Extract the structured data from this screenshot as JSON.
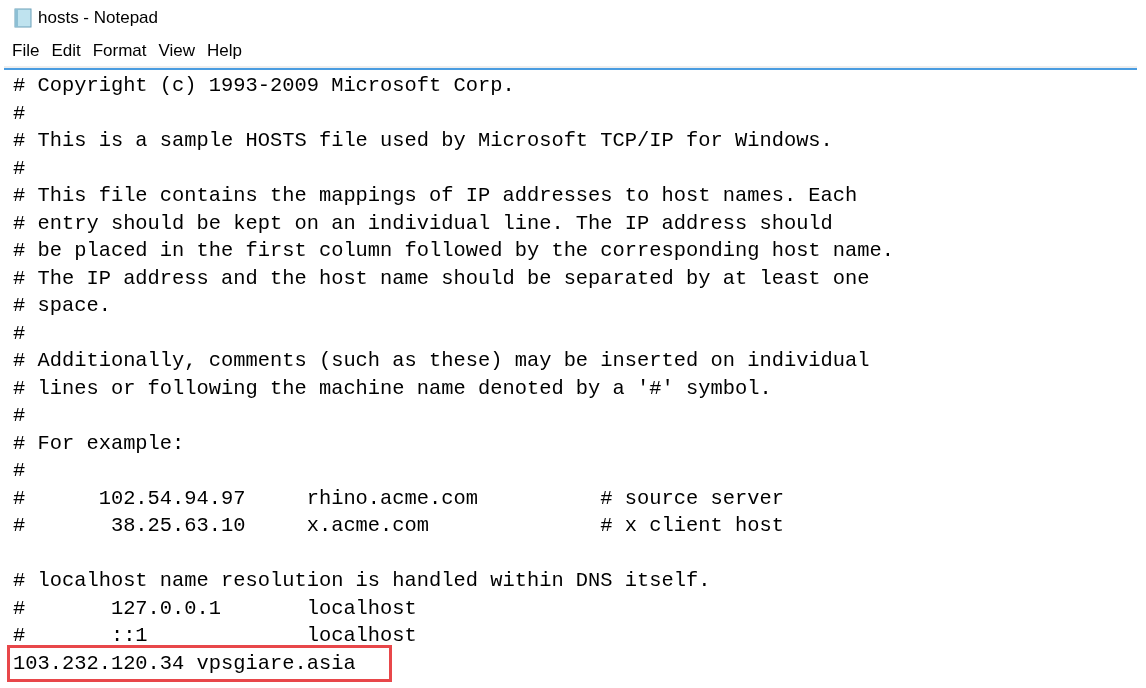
{
  "window": {
    "title": "hosts - Notepad"
  },
  "menu": [
    {
      "label": "File"
    },
    {
      "label": "Edit"
    },
    {
      "label": "Format"
    },
    {
      "label": "View"
    },
    {
      "label": "Help"
    }
  ],
  "lines": [
    {
      "kind": "text",
      "text": "# Copyright (c) 1993-2009 Microsoft Corp.",
      "highlighted": false
    },
    {
      "kind": "text",
      "text": "#",
      "highlighted": false
    },
    {
      "kind": "text",
      "text": "# This is a sample HOSTS file used by Microsoft TCP/IP for Windows.",
      "highlighted": false
    },
    {
      "kind": "text",
      "text": "#",
      "highlighted": false
    },
    {
      "kind": "text",
      "text": "# This file contains the mappings of IP addresses to host names. Each",
      "highlighted": false
    },
    {
      "kind": "text",
      "text": "# entry should be kept on an individual line. The IP address should",
      "highlighted": false
    },
    {
      "kind": "text",
      "text": "# be placed in the first column followed by the corresponding host name.",
      "highlighted": false
    },
    {
      "kind": "text",
      "text": "# The IP address and the host name should be separated by at least one",
      "highlighted": false
    },
    {
      "kind": "text",
      "text": "# space.",
      "highlighted": false
    },
    {
      "kind": "text",
      "text": "#",
      "highlighted": false
    },
    {
      "kind": "text",
      "text": "# Additionally, comments (such as these) may be inserted on individual",
      "highlighted": false
    },
    {
      "kind": "text",
      "text": "# lines or following the machine name denoted by a '#' symbol.",
      "highlighted": false
    },
    {
      "kind": "text",
      "text": "#",
      "highlighted": false
    },
    {
      "kind": "text",
      "text": "# For example:",
      "highlighted": false
    },
    {
      "kind": "text",
      "text": "#",
      "highlighted": false
    },
    {
      "kind": "text",
      "text": "#      102.54.94.97     rhino.acme.com          # source server",
      "highlighted": false
    },
    {
      "kind": "text",
      "text": "#       38.25.63.10     x.acme.com              # x client host",
      "highlighted": false
    },
    {
      "kind": "blank",
      "highlighted": false
    },
    {
      "kind": "text",
      "text": "# localhost name resolution is handled within DNS itself.",
      "highlighted": false
    },
    {
      "kind": "text",
      "text": "#       127.0.0.1       localhost",
      "highlighted": false
    },
    {
      "kind": "text",
      "text": "#       ::1             localhost",
      "highlighted": false
    },
    {
      "kind": "text",
      "text": "103.232.120.34 vpsgiare.asia",
      "highlighted": true
    }
  ]
}
